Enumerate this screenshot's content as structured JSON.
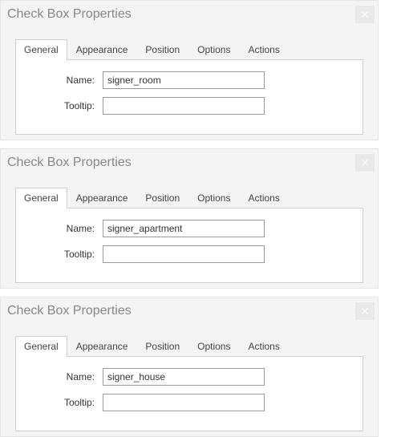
{
  "dialogs": [
    {
      "title": "Check Box Properties",
      "tabs": [
        "General",
        "Appearance",
        "Position",
        "Options",
        "Actions"
      ],
      "active_tab": 0,
      "fields": {
        "name_label": "Name:",
        "name_value": "signer_room",
        "tooltip_label": "Tooltip:",
        "tooltip_value": ""
      }
    },
    {
      "title": "Check Box Properties",
      "tabs": [
        "General",
        "Appearance",
        "Position",
        "Options",
        "Actions"
      ],
      "active_tab": 0,
      "fields": {
        "name_label": "Name:",
        "name_value": "signer_apartment",
        "tooltip_label": "Tooltip:",
        "tooltip_value": ""
      }
    },
    {
      "title": "Check Box Properties",
      "tabs": [
        "General",
        "Appearance",
        "Position",
        "Options",
        "Actions"
      ],
      "active_tab": 0,
      "fields": {
        "name_label": "Name:",
        "name_value": "signer_house",
        "tooltip_label": "Tooltip:",
        "tooltip_value": ""
      }
    }
  ],
  "icons": {
    "close": "✕"
  }
}
